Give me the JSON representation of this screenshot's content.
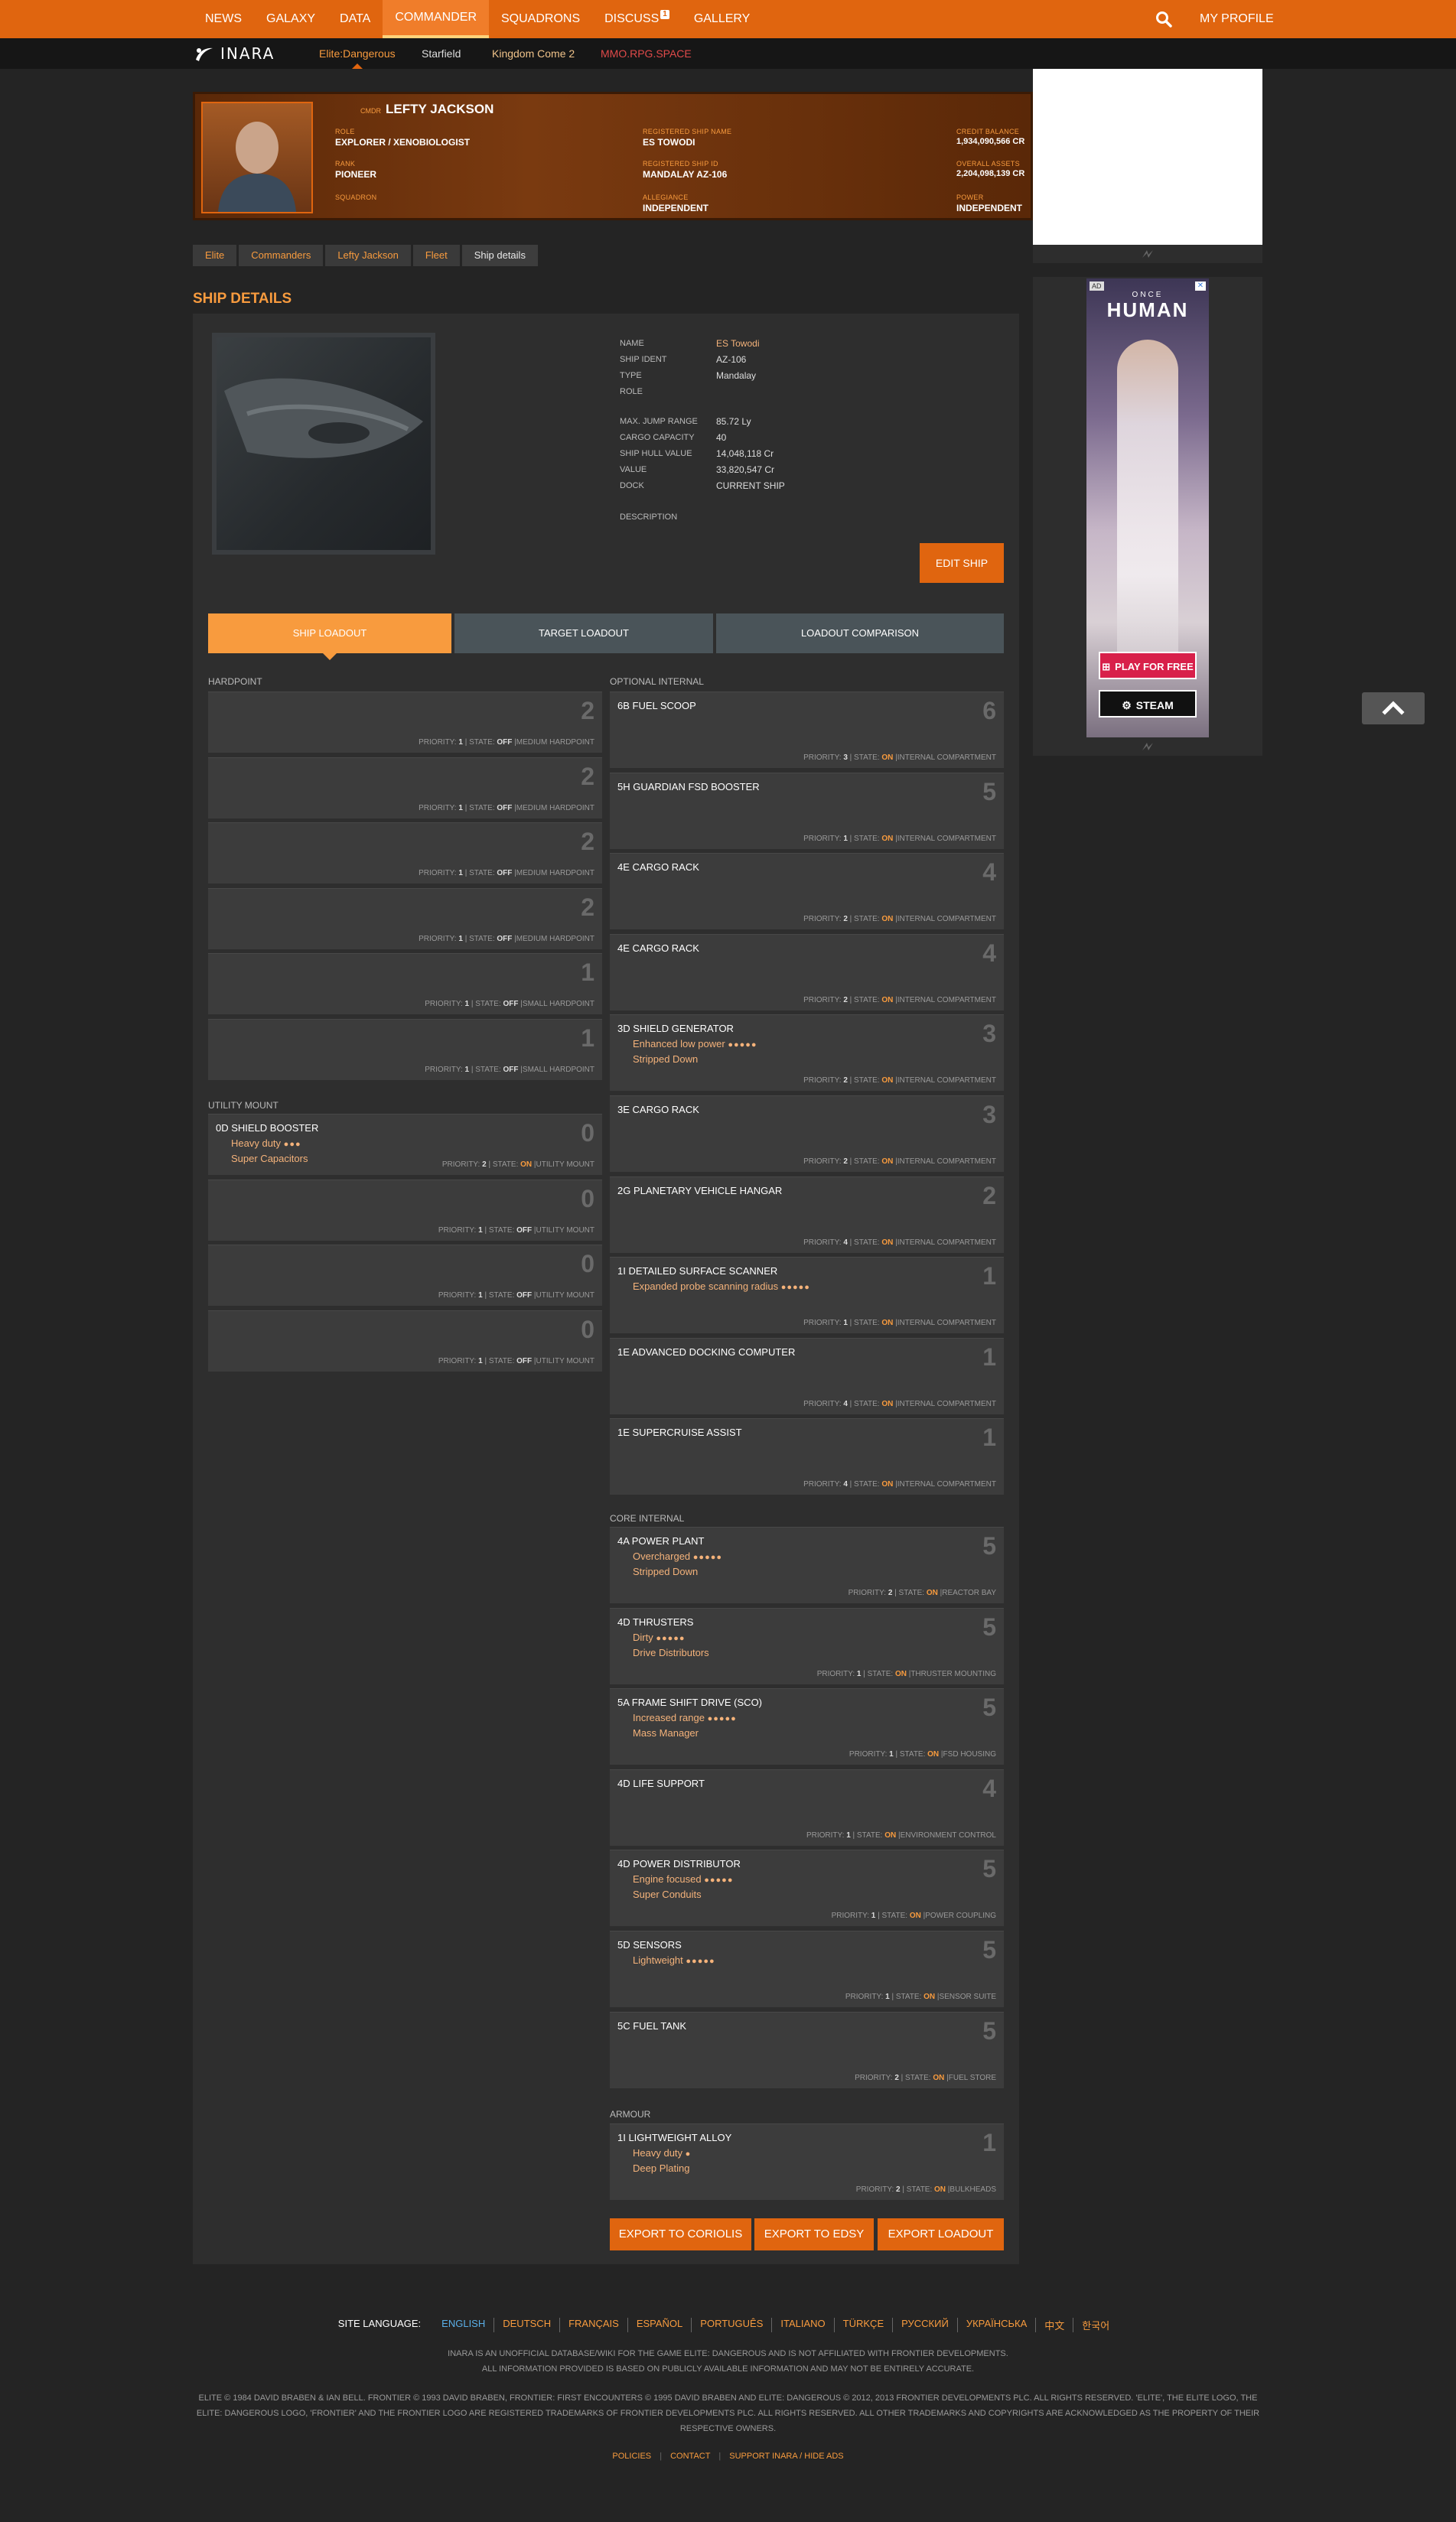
{
  "topnav": {
    "items": [
      "NEWS",
      "GALAXY",
      "DATA",
      "COMMANDER",
      "SQUADRONS",
      "DISCUSS",
      "GALLERY"
    ],
    "discuss_badge": "1",
    "profile": "MY PROFILE"
  },
  "subnav": {
    "logo": "INARA",
    "games": [
      "Elite:Dangerous",
      "Starfield",
      "Kingdom Come 2",
      "MMO.RPG.SPACE"
    ]
  },
  "commander": {
    "prefix": "CMDR",
    "name": "LEFTY JACKSON",
    "role_label": "ROLE",
    "role": "EXPLORER / XENOBIOLOGIST",
    "rank_label": "RANK",
    "rank": "PIONEER",
    "squadron_label": "SQUADRON",
    "ship_name_label": "REGISTERED SHIP NAME",
    "ship_name": "ES TOWODI",
    "ship_id_label": "REGISTERED SHIP ID",
    "ship_id": "MANDALAY AZ-106",
    "allegiance_label": "ALLEGIANCE",
    "allegiance": "INDEPENDENT",
    "credit_label": "CREDIT BALANCE",
    "credit": "1,934,090,566 CR",
    "assets_label": "OVERALL ASSETS",
    "assets": "2,204,098,139 CR",
    "power_label": "POWER",
    "power": "INDEPENDENT"
  },
  "breadcrumbs": [
    "Elite",
    "Commanders",
    "Lefty Jackson",
    "Fleet",
    "Ship details"
  ],
  "page_title": "SHIP DETAILS",
  "details": [
    {
      "k": "NAME",
      "v": "ES Towodi"
    },
    {
      "k": "SHIP IDENT",
      "v": "AZ-106"
    },
    {
      "k": "TYPE",
      "v": "Mandalay"
    },
    {
      "k": "ROLE",
      "v": ""
    },
    {
      "k": "MAX. JUMP RANGE",
      "v": "85.72 Ly"
    },
    {
      "k": "CARGO CAPACITY",
      "v": "40"
    },
    {
      "k": "SHIP HULL VALUE",
      "v": "14,048,118 Cr"
    },
    {
      "k": "VALUE",
      "v": "33,820,547 Cr"
    },
    {
      "k": "DOCK",
      "v": "CURRENT SHIP"
    },
    {
      "k": "DESCRIPTION",
      "v": ""
    }
  ],
  "edit_button": "EDIT SHIP",
  "tabs": [
    "SHIP LOADOUT",
    "TARGET LOADOUT",
    "LOADOUT COMPARISON"
  ],
  "sections": {
    "hardpoint": "HARDPOINT",
    "utility": "UTILITY MOUNT",
    "optional": "OPTIONAL INTERNAL",
    "core": "CORE INTERNAL",
    "armour": "ARMOUR"
  },
  "hardpoints": [
    {
      "size": "2",
      "priority": "1",
      "state": "OFF",
      "slot": "MEDIUM HARDPOINT"
    },
    {
      "size": "2",
      "priority": "1",
      "state": "OFF",
      "slot": "MEDIUM HARDPOINT"
    },
    {
      "size": "2",
      "priority": "1",
      "state": "OFF",
      "slot": "MEDIUM HARDPOINT"
    },
    {
      "size": "2",
      "priority": "1",
      "state": "OFF",
      "slot": "MEDIUM HARDPOINT"
    },
    {
      "size": "1",
      "priority": "1",
      "state": "OFF",
      "slot": "SMALL HARDPOINT"
    },
    {
      "size": "1",
      "priority": "1",
      "state": "OFF",
      "slot": "SMALL HARDPOINT"
    }
  ],
  "utility": [
    {
      "name": "0D SHIELD BOOSTER",
      "size": "0",
      "eng": "Heavy duty",
      "grade": 3,
      "exp": "Super Capacitors",
      "priority": "2",
      "state": "ON",
      "slot": "UTILITY MOUNT"
    },
    {
      "size": "0",
      "priority": "1",
      "state": "OFF",
      "slot": "UTILITY MOUNT"
    },
    {
      "size": "0",
      "priority": "1",
      "state": "OFF",
      "slot": "UTILITY MOUNT"
    },
    {
      "size": "0",
      "priority": "1",
      "state": "OFF",
      "slot": "UTILITY MOUNT"
    }
  ],
  "optional": [
    {
      "name": "6B FUEL SCOOP",
      "size": "6",
      "priority": "3",
      "state": "ON",
      "slot": "INTERNAL COMPARTMENT"
    },
    {
      "name": "5H GUARDIAN FSD BOOSTER",
      "size": "5",
      "priority": "1",
      "state": "ON",
      "slot": "INTERNAL COMPARTMENT"
    },
    {
      "name": "4E CARGO RACK",
      "size": "4",
      "priority": "2",
      "state": "ON",
      "slot": "INTERNAL COMPARTMENT"
    },
    {
      "name": "4E CARGO RACK",
      "size": "4",
      "priority": "2",
      "state": "ON",
      "slot": "INTERNAL COMPARTMENT"
    },
    {
      "name": "3D SHIELD GENERATOR",
      "size": "3",
      "eng": "Enhanced low power",
      "grade": 5,
      "exp": "Stripped Down",
      "priority": "2",
      "state": "ON",
      "slot": "INTERNAL COMPARTMENT"
    },
    {
      "name": "3E CARGO RACK",
      "size": "3",
      "priority": "2",
      "state": "ON",
      "slot": "INTERNAL COMPARTMENT"
    },
    {
      "name": "2G PLANETARY VEHICLE HANGAR",
      "size": "2",
      "priority": "4",
      "state": "ON",
      "slot": "INTERNAL COMPARTMENT"
    },
    {
      "name": "1I DETAILED SURFACE SCANNER",
      "size": "1",
      "eng": "Expanded probe scanning radius",
      "grade": 5,
      "priority": "1",
      "state": "ON",
      "slot": "INTERNAL COMPARTMENT"
    },
    {
      "name": "1E ADVANCED DOCKING COMPUTER",
      "size": "1",
      "priority": "4",
      "state": "ON",
      "slot": "INTERNAL COMPARTMENT"
    },
    {
      "name": "1E SUPERCRUISE ASSIST",
      "size": "1",
      "priority": "4",
      "state": "ON",
      "slot": "INTERNAL COMPARTMENT"
    }
  ],
  "core": [
    {
      "name": "4A POWER PLANT",
      "size": "5",
      "eng": "Overcharged",
      "grade": 5,
      "exp": "Stripped Down",
      "priority": "2",
      "state": "ON",
      "slot": "REACTOR BAY"
    },
    {
      "name": "4D THRUSTERS",
      "size": "5",
      "eng": "Dirty",
      "grade": 5,
      "exp": "Drive Distributors",
      "priority": "1",
      "state": "ON",
      "slot": "THRUSTER MOUNTING"
    },
    {
      "name": "5A FRAME SHIFT DRIVE (SCO)",
      "size": "5",
      "eng": "Increased range",
      "grade": 5,
      "exp": "Mass Manager",
      "priority": "1",
      "state": "ON",
      "slot": "FSD HOUSING"
    },
    {
      "name": "4D LIFE SUPPORT",
      "size": "4",
      "priority": "1",
      "state": "ON",
      "slot": "ENVIRONMENT CONTROL"
    },
    {
      "name": "4D POWER DISTRIBUTOR",
      "size": "5",
      "eng": "Engine focused",
      "grade": 5,
      "exp": "Super Conduits",
      "priority": "1",
      "state": "ON",
      "slot": "POWER COUPLING"
    },
    {
      "name": "5D SENSORS",
      "size": "5",
      "eng": "Lightweight",
      "grade": 5,
      "priority": "1",
      "state": "ON",
      "slot": "SENSOR SUITE"
    },
    {
      "name": "5C FUEL TANK",
      "size": "5",
      "priority": "2",
      "state": "ON",
      "slot": "FUEL STORE"
    }
  ],
  "armour": [
    {
      "name": "1I LIGHTWEIGHT ALLOY",
      "size": "1",
      "eng": "Heavy duty",
      "grade": 1,
      "exp": "Deep Plating",
      "priority": "2",
      "state": "ON",
      "slot": "BULKHEADS"
    }
  ],
  "export_buttons": [
    "EXPORT TO CORIOLIS",
    "EXPORT TO EDSY",
    "EXPORT LOADOUT"
  ],
  "footer": {
    "lang_label": "SITE LANGUAGE:",
    "languages": [
      "ENGLISH",
      "DEUTSCH",
      "FRANÇAIS",
      "ESPAÑOL",
      "PORTUGUÊS",
      "ITALIANO",
      "TÜRKÇE",
      "РУССКИЙ",
      "УКРАЇНСЬКА",
      "中文",
      "한국어"
    ],
    "note1": "INARA IS AN UNOFFICIAL DATABASE/WIKI FOR THE GAME ELITE: DANGEROUS AND IS NOT AFFILIATED WITH FRONTIER DEVELOPMENTS.",
    "note2": "ALL INFORMATION PROVIDED IS BASED ON PUBLICLY AVAILABLE INFORMATION AND MAY NOT BE ENTIRELY ACCURATE.",
    "legal": "ELITE © 1984 DAVID BRABEN & IAN BELL. FRONTIER © 1993 DAVID BRABEN, FRONTIER: FIRST ENCOUNTERS © 1995 DAVID BRABEN AND ELITE: DANGEROUS © 2012, 2013 FRONTIER DEVELOPMENTS PLC. ALL RIGHTS RESERVED. 'ELITE', THE ELITE LOGO, THE ELITE: DANGEROUS LOGO, 'FRONTIER' AND THE FRONTIER LOGO ARE REGISTERED TRADEMARKS OF FRONTIER DEVELOPMENTS PLC. ALL RIGHTS RESERVED. ALL OTHER TRADEMARKS AND COPYRIGHTS ARE ACKNOWLEDGED AS THE PROPERTY OF THEIR RESPECTIVE OWNERS.",
    "links": [
      "POLICIES",
      "CONTACT",
      "SUPPORT INARA / HIDE ADS"
    ]
  },
  "ads": {
    "side_title": "HUMAN",
    "side_pre": "ONCE",
    "side_cta": "PLAY FOR FREE",
    "side_store": "STEAM",
    "ad_mark": "AD"
  },
  "colors": {
    "accent": "#e0650f",
    "accent_light": "#f89b3e",
    "panel": "#2e2e2e",
    "slot": "#3c3c3c"
  }
}
